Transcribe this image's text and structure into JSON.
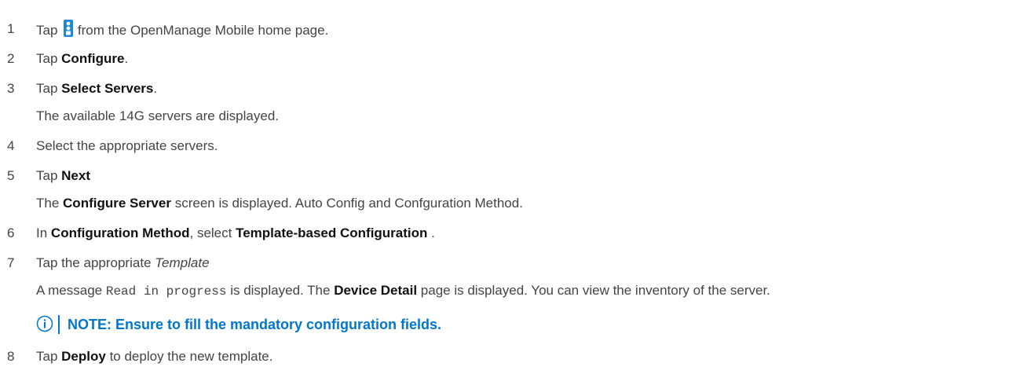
{
  "steps": [
    {
      "num": "1",
      "pre": "Tap",
      "post": "from the OpenManage Mobile home page.",
      "icon": "openmanage-app-icon"
    },
    {
      "num": "2",
      "pre": "Tap",
      "bold": "Configure",
      "post": "."
    },
    {
      "num": "3",
      "pre": "Tap",
      "bold": "Select Servers",
      "post": ".",
      "result": "The available 14G servers are displayed."
    },
    {
      "num": "4",
      "text": "Select the appropriate servers."
    },
    {
      "num": "5",
      "pre": "Tap",
      "bold": "Next",
      "result_pre": "The",
      "result_bold": "Configure Server",
      "result_post": "screen is displayed. Auto Config and Confguration Method."
    },
    {
      "num": "6",
      "pre": "In",
      "bold": "Configuration Method",
      "mid": ", select",
      "bold2": "Template-based Configuration",
      "post": " ."
    },
    {
      "num": "7",
      "pre": "Tap the appropriate",
      "italic": "Template",
      "result_pre": "A message",
      "result_code": "Read in progress",
      "result_mid": "is displayed. The",
      "result_bold": "Device Detail",
      "result_post": "page is displayed. You can view the inventory of the server."
    },
    {
      "num": "8",
      "pre": "Tap",
      "bold": "Deploy",
      "post": "to deploy the new template."
    }
  ],
  "note": {
    "label": "NOTE:",
    "text": "Ensure to fill the mandatory configuration fields.",
    "icon": "info-icon"
  },
  "colors": {
    "accent": "#0076ce",
    "text": "#444444",
    "bold": "#111111"
  }
}
